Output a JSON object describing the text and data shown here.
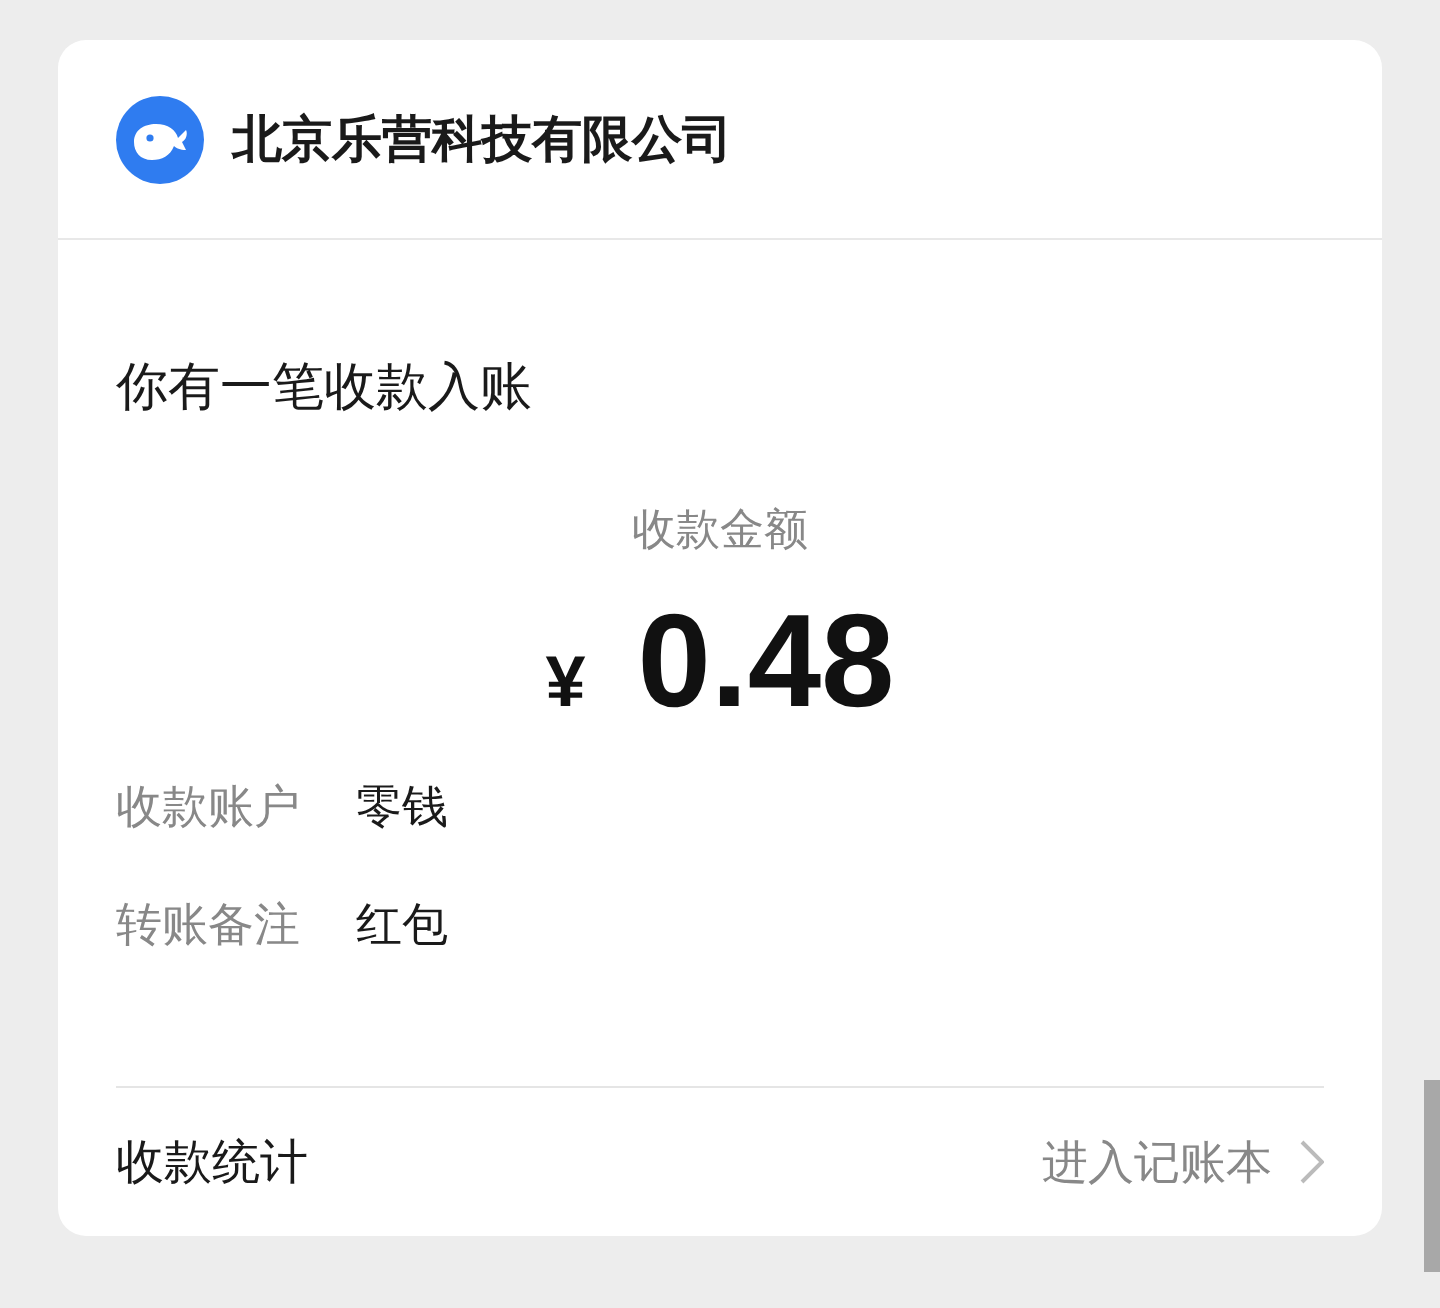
{
  "header": {
    "company": "北京乐营科技有限公司"
  },
  "message": {
    "title": "你有一笔收款入账",
    "amount_label": "收款金额",
    "currency": "¥",
    "amount": "0.48",
    "details": [
      {
        "label": "收款账户",
        "value": "零钱"
      },
      {
        "label": "转账备注",
        "value": "红包"
      }
    ]
  },
  "footer": {
    "label": "收款统计",
    "link": "进入记账本"
  }
}
